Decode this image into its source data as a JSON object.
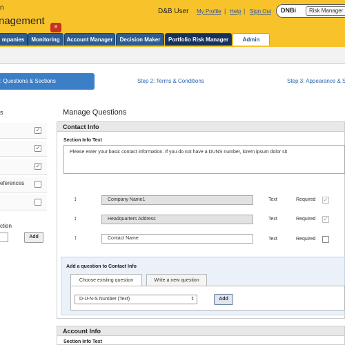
{
  "header": {
    "app_title": "nagement",
    "user_name": "D&B User",
    "links": [
      "My Profile",
      "Help",
      "Sign Out"
    ],
    "separator": "|",
    "dnbi_logo": "DNBi",
    "product_select": "Risk Manager"
  },
  "nav": {
    "tabs": [
      "mpanies",
      "Monitoring",
      "Account Manager",
      "Decision Maker",
      "Portfolio Risk Manager",
      "Admin"
    ],
    "monitoring_badge": "8"
  },
  "subbar": {
    "title": "n"
  },
  "steps": {
    "step1": ": Questions & Sections",
    "step2": "Step 2: Terms & Conditions",
    "step3": "Step 3: Appearance & S"
  },
  "left_panel": {
    "heading": "s",
    "rows": [
      {
        "label": "",
        "checked": true
      },
      {
        "label": "",
        "checked": true
      },
      {
        "label": "",
        "checked": true
      },
      {
        "label": "eferences",
        "checked": false
      },
      {
        "label": "",
        "checked": false
      }
    ],
    "section_label": "ction",
    "add_button": "Add"
  },
  "main": {
    "title": "Manage Questions",
    "contact_section": {
      "heading": "Contact Info",
      "info_label": "Section Info Text",
      "info_text": "Please enter your basic contact information. If you do not have a DUNS number, lorem ipsum dolor sit",
      "questions": [
        {
          "drag": "↕",
          "name": "Company Name1",
          "type": "Text",
          "required_label": "Required",
          "required": true,
          "disabled": true
        },
        {
          "drag": "↕",
          "name": "Headquarters Address",
          "type": "Text",
          "required_label": "Required",
          "required": true,
          "disabled": true
        },
        {
          "drag": "↕",
          "name": "Contact Name",
          "type": "Text",
          "required_label": "Required",
          "required": false,
          "disabled": false
        }
      ]
    },
    "add_question": {
      "title": "Add a question to Contact Info",
      "tabs": [
        "Choose existing question",
        "Write a new question"
      ],
      "selected_question": "D-U-N-S Number (Text)",
      "add_button": "Add"
    },
    "account_section": {
      "heading": "Account Info",
      "info_label": "Section Info Text"
    }
  },
  "colors": {
    "header_yellow": "#f8c32a",
    "tab_blue": "#2d5c8f",
    "step_blue": "#3b80c7",
    "badge_red": "#c6331f"
  }
}
